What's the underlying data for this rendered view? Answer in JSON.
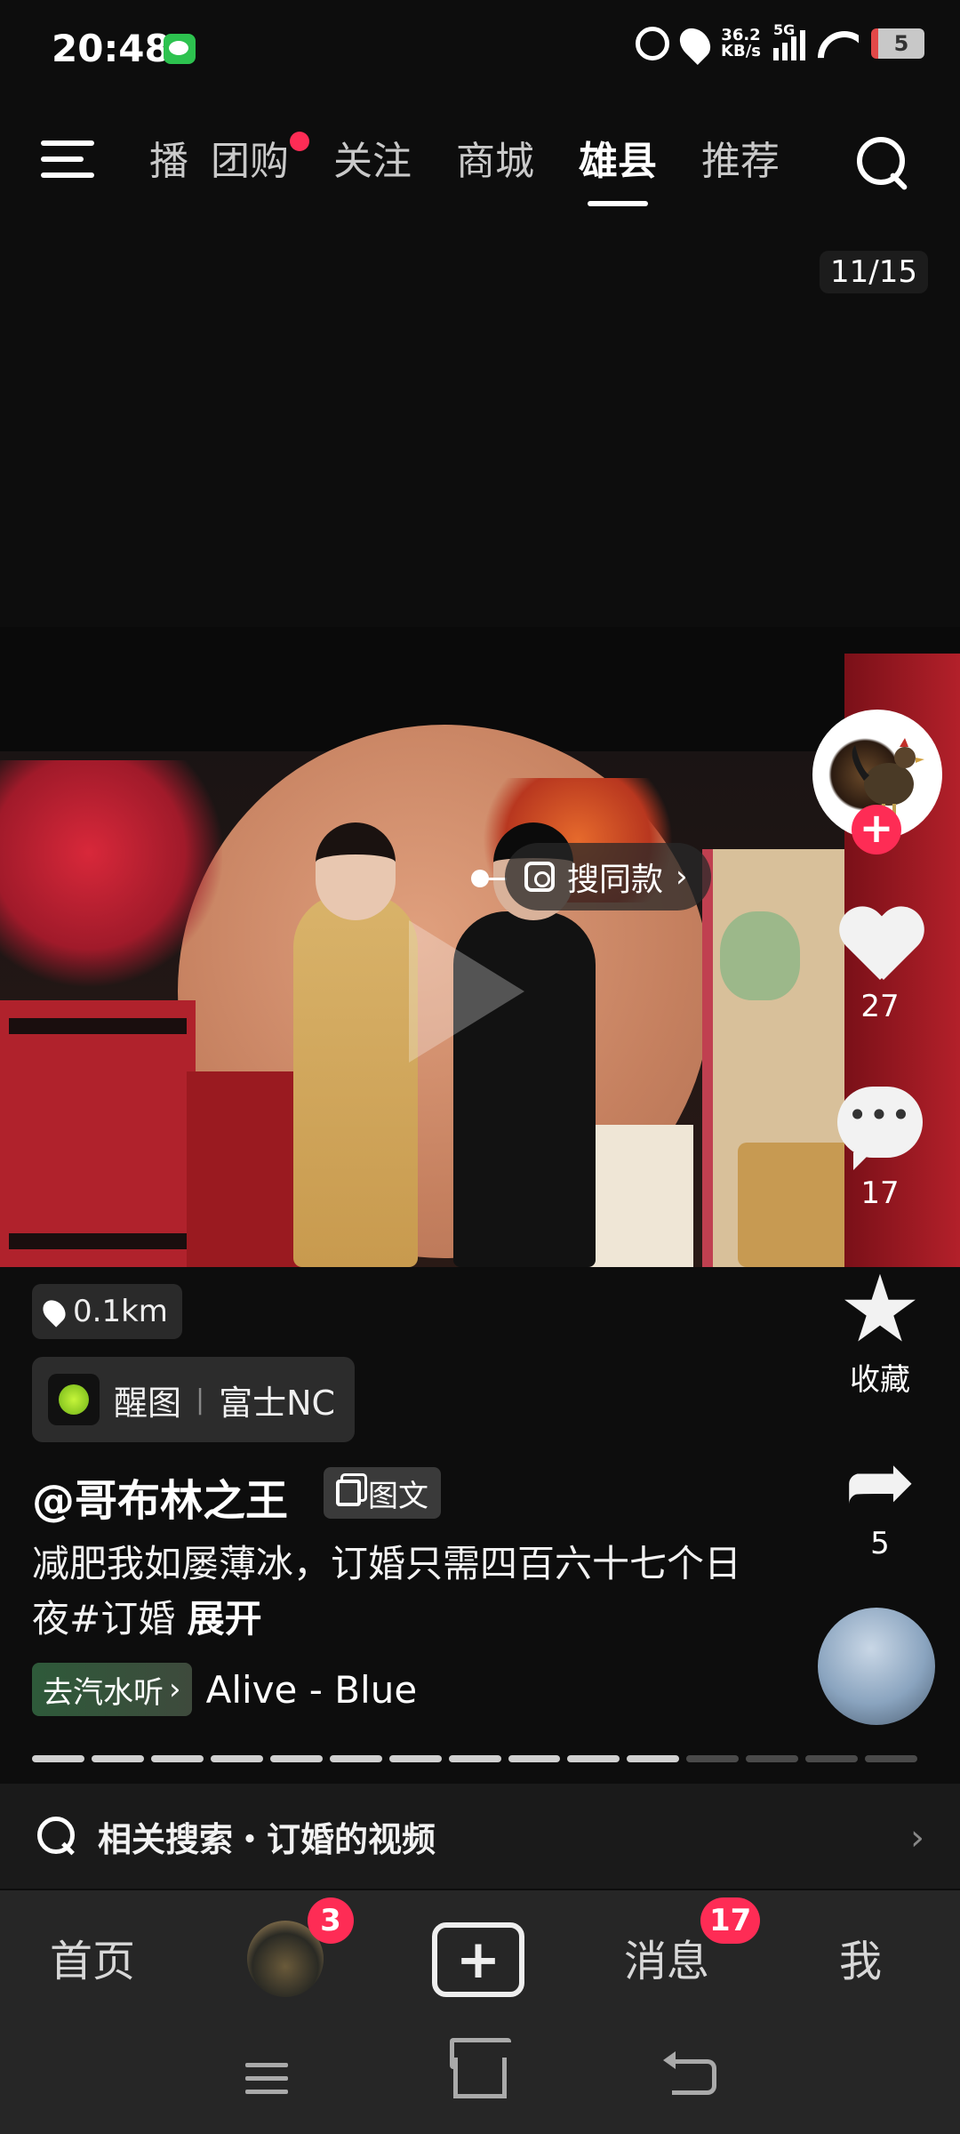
{
  "status_bar": {
    "time": "20:48",
    "net_speed_value": "36.2",
    "net_speed_unit": "KB/s",
    "network": "5G",
    "battery": "5",
    "icons": [
      "wechat-icon",
      "alarm-icon",
      "location-icon",
      "signal-icon",
      "wifi-icon",
      "battery-icon"
    ]
  },
  "top_nav": {
    "tabs": [
      {
        "label": "播",
        "active": false
      },
      {
        "label": "团购",
        "active": false,
        "dot": true
      },
      {
        "label": "关注",
        "active": false
      },
      {
        "label": "商城",
        "active": false
      },
      {
        "label": "雄县",
        "active": true
      },
      {
        "label": "推荐",
        "active": false
      }
    ]
  },
  "pager": "11/15",
  "photo": {
    "find_same_label": "搜同款"
  },
  "actions": {
    "likes": "27",
    "comments": "17",
    "favorite_label": "收藏",
    "shares": "5"
  },
  "info": {
    "distance": "0.1km",
    "app_name": "醒图",
    "app_sep": "|",
    "camera_filter": "富士NC",
    "author": "@哥布林之王",
    "post_type": "图文",
    "caption": "减肥我如屡薄冰，订婚只需四百六十七个日夜#订婚",
    "caption_more": "展开",
    "music_source": "去汽水听",
    "song": "Alive - Blue"
  },
  "progress": {
    "total": 15,
    "current": 11
  },
  "related": {
    "text": "相关搜索・订婚的视频"
  },
  "bottom_nav": {
    "home": "首页",
    "friends_badge": "3",
    "messages": "消息",
    "messages_badge": "17",
    "me": "我"
  },
  "colors": {
    "accent": "#fe2c55",
    "background": "#0d0d0d",
    "bar": "#262626"
  }
}
